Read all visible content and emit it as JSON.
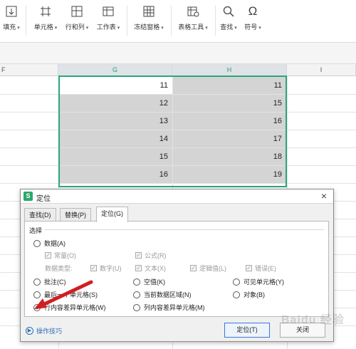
{
  "ribbon": {
    "fill": "填充",
    "cell": "单元格",
    "row_col": "行和列",
    "worksheet": "工作表",
    "freeze": "冻结窗格",
    "table_tools": "表格工具",
    "find": "查找",
    "symbol": "符号"
  },
  "grid": {
    "columns": [
      "F",
      "G",
      "H",
      "I"
    ],
    "rows": [
      {
        "g": "11",
        "h": "11"
      },
      {
        "g": "12",
        "h": "15"
      },
      {
        "g": "13",
        "h": "16"
      },
      {
        "g": "14",
        "h": "17"
      },
      {
        "g": "15",
        "h": "18"
      },
      {
        "g": "16",
        "h": "19"
      }
    ]
  },
  "dialog": {
    "logo": "S",
    "title": "定位",
    "close": "×",
    "tabs": [
      "查找(D)",
      "替换(P)",
      "定位(G)"
    ],
    "active_tab": "定位(G)",
    "group_label": "选择",
    "opt_data": "数据(A)",
    "opt_constant": "常量(O)",
    "opt_formula": "公式(R)",
    "datatype_label": "数据类型:",
    "type_number": "数字(U)",
    "type_text": "文本(X)",
    "type_logical": "逻辑值(L)",
    "type_error": "错误(E)",
    "opt_comment": "批注(C)",
    "opt_blank": "空值(K)",
    "opt_visible": "可见单元格(Y)",
    "opt_last": "最后一个单元格(S)",
    "opt_current_region": "当前数据区域(N)",
    "opt_object": "对象(B)",
    "opt_row_diff": "行内容差异单元格(W)",
    "opt_col_diff": "列内容差异单元格(M)",
    "tips": "操作技巧",
    "ok": "定位(T)",
    "close_btn": "关闭",
    "selected_option": "行内容差异单元格(W)"
  },
  "colors": {
    "accent": "#2aa877",
    "link": "#2b6fb6",
    "arrow": "#d11f1f"
  },
  "watermark": "Baidu 经验"
}
